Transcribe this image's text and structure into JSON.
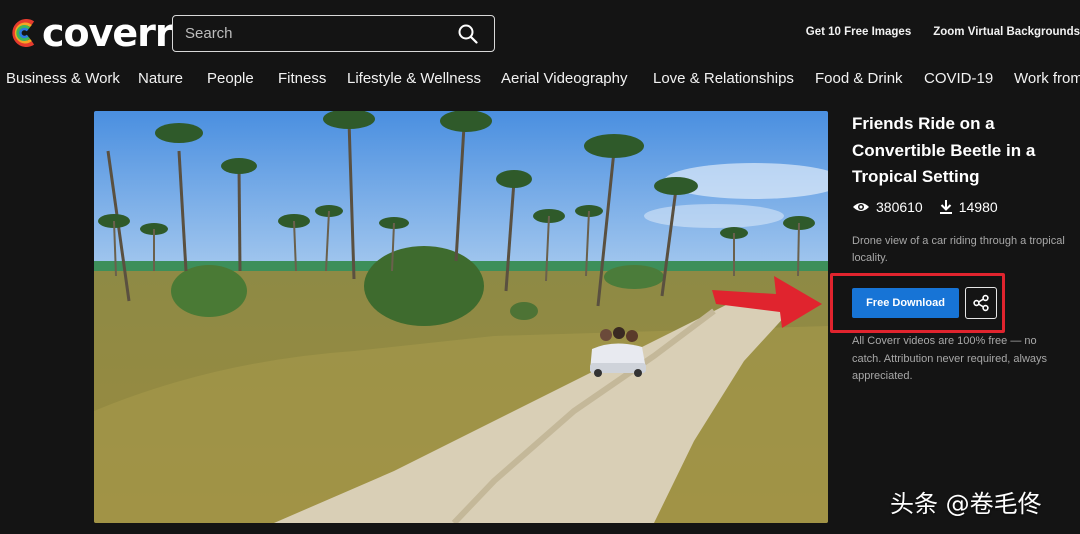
{
  "header": {
    "logo_text": "coverr",
    "search_placeholder": "Search",
    "links": [
      "Get 10 Free Images",
      "Zoom Virtual Backgrounds"
    ]
  },
  "categories": [
    "Business & Work",
    "Nature",
    "People",
    "Fitness",
    "Lifestyle & Wellness",
    "Aerial Videography",
    "Love & Relationships",
    "Food & Drink",
    "COVID-19",
    "Work from Home"
  ],
  "video": {
    "title": "Friends Ride on a Convertible Beetle in a Tropical Setting",
    "views": "380610",
    "downloads": "14980",
    "description": "Drone view of a car riding through a tropical locality.",
    "download_label": "Free Download",
    "free_note": "All Coverr videos are 100% free — no catch. Attribution never required, always appreciated."
  },
  "icons": {
    "search": "search-icon",
    "views": "eye-icon",
    "downloads": "download-icon",
    "share": "share-icon"
  },
  "colors": {
    "background": "#141414",
    "accent_blue": "#1774d6",
    "highlight_red": "#e0242e"
  },
  "watermark": "头条 @卷毛佟"
}
